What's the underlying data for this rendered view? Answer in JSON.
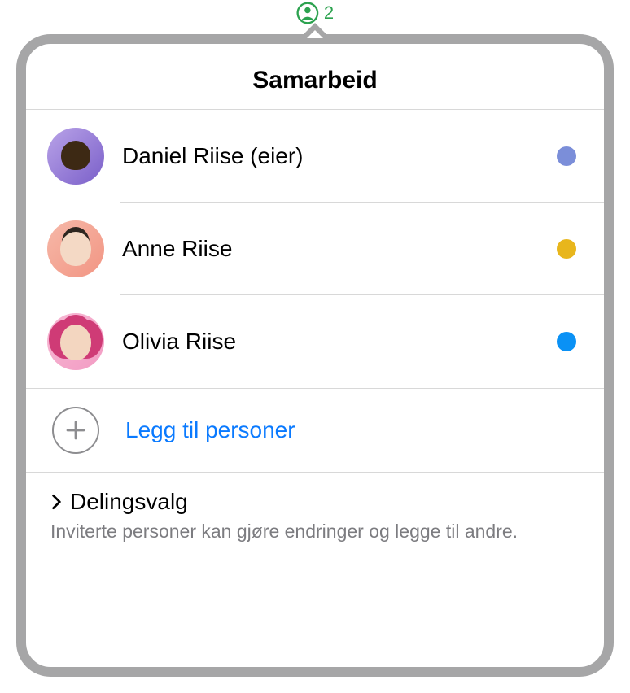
{
  "indicator": {
    "count": "2",
    "color": "#2ca24f"
  },
  "popover": {
    "title": "Samarbeid"
  },
  "participants": [
    {
      "name": "Daniel Riise (eier)",
      "dot_color": "#7b8ed9"
    },
    {
      "name": "Anne Riise",
      "dot_color": "#e8b61c"
    },
    {
      "name": "Olivia Riise",
      "dot_color": "#0a91f5"
    }
  ],
  "add_people": {
    "label": "Legg til personer"
  },
  "share_options": {
    "title": "Delingsvalg",
    "description": "Inviterte personer kan gjøre endringer og legge til andre."
  }
}
